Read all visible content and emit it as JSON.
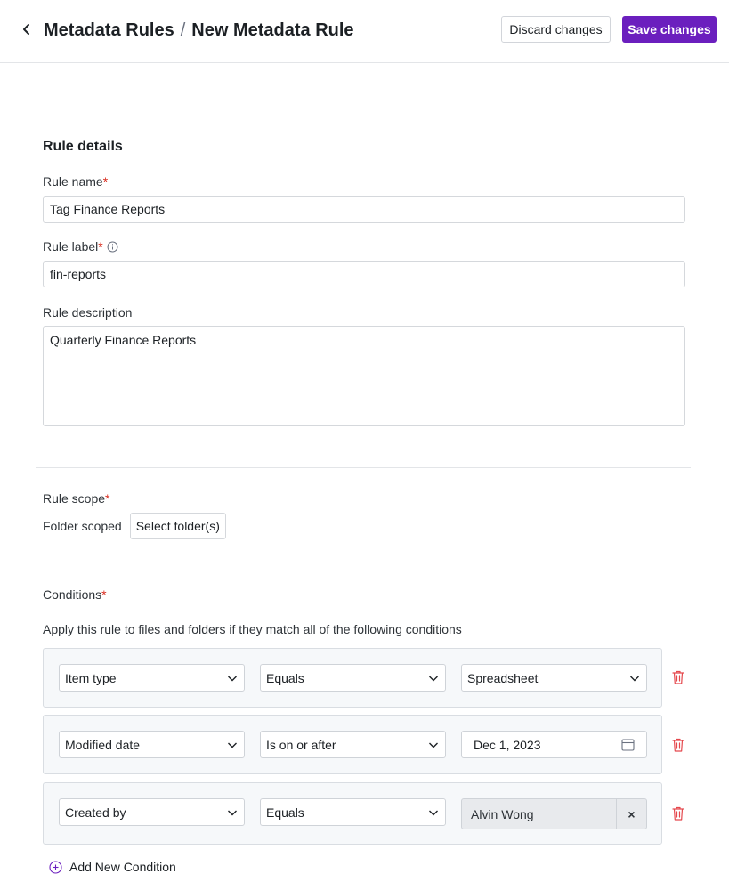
{
  "header": {
    "breadcrumb_parent": "Metadata Rules",
    "breadcrumb_separator": "/",
    "breadcrumb_current": "New Metadata Rule",
    "discard_label": "Discard changes",
    "save_label": "Save changes",
    "accent_color": "#6b1fbe"
  },
  "details": {
    "section_title": "Rule details",
    "required_marker": "*",
    "name_label": "Rule name",
    "name_value": "Tag Finance Reports",
    "label_label": "Rule label",
    "label_value": "fin-reports",
    "description_label": "Rule description",
    "description_value": "Quarterly Finance Reports"
  },
  "scope": {
    "label": "Rule scope",
    "type_text": "Folder scoped",
    "select_button": "Select folder(s)"
  },
  "conditions": {
    "label": "Conditions",
    "description": "Apply this rule to files and folders if they match all of the following conditions",
    "rows": [
      {
        "field": "Item type",
        "operator": "Equals",
        "value": "Spreadsheet"
      },
      {
        "field": "Modified date",
        "operator": "Is on or after",
        "value": "Dec 1, 2023"
      },
      {
        "field": "Created by",
        "operator": "Equals",
        "value": "Alvin Wong"
      }
    ],
    "chip_remove": "×",
    "add_label": "Add New Condition"
  },
  "icons": {
    "back": "chevron-left-icon",
    "info": "info-icon",
    "chevron": "chevron-down-icon",
    "calendar": "calendar-icon",
    "trash": "trash-icon",
    "add": "plus-circle-icon"
  },
  "colors": {
    "required": "#d92d20",
    "delete": "#e5484d"
  }
}
